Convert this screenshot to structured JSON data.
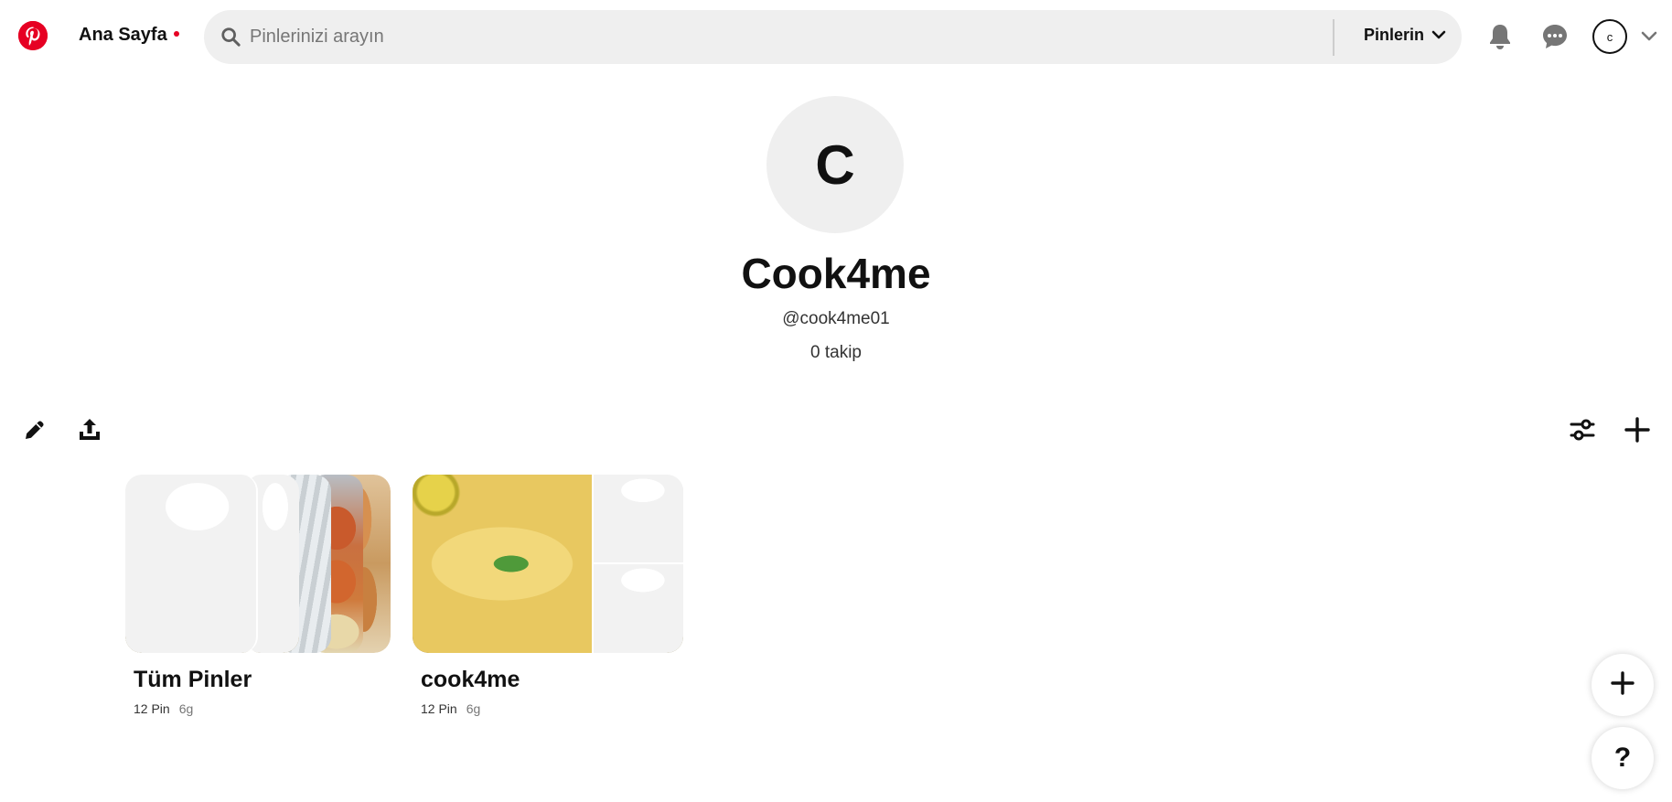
{
  "header": {
    "home_label": "Ana Sayfa",
    "search_placeholder": "Pinlerinizi arayın",
    "scope_label": "Pinlerin",
    "account_initial": "c"
  },
  "profile": {
    "initial": "C",
    "name": "Cook4me",
    "handle": "@cook4me01",
    "following": "0 takip"
  },
  "boards": [
    {
      "title": "Tüm Pinler",
      "pin_count": "12 Pin",
      "age": "6g"
    },
    {
      "title": "cook4me",
      "pin_count": "12 Pin",
      "age": "6g"
    }
  ],
  "floating": {
    "help_label": "?"
  },
  "colors": {
    "brand": "#e60023",
    "search_bg": "#efefef",
    "text": "#111111",
    "muted": "#767676"
  },
  "icons": {
    "logo": "pinterest-logo-icon",
    "search": "search-icon",
    "notifications": "bell-icon",
    "messages": "chat-bubble-icon",
    "edit": "pencil-icon",
    "share": "upload-icon",
    "filter": "sliders-icon",
    "create": "plus-icon"
  }
}
